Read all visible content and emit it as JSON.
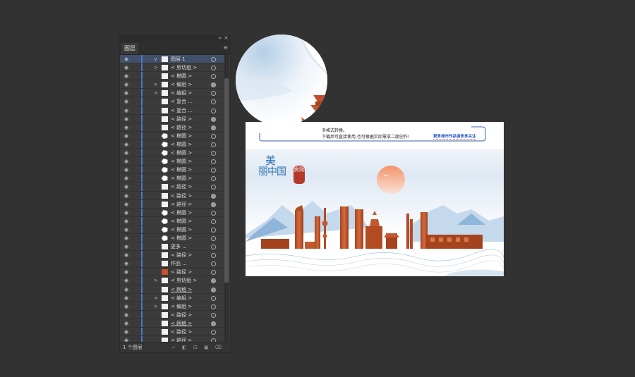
{
  "panel": {
    "tab_label": "图层",
    "collapse_icon": "«",
    "close_icon": "×",
    "menu_icon": "≡",
    "layer_count": "1 个图层",
    "rows": [
      {
        "label": "图层 1",
        "arrow": "∨",
        "layer": true,
        "thumb": "plain",
        "target": "ring"
      },
      {
        "label": "< 剪切组 >",
        "arrow": ">",
        "thumb": "plain",
        "target": "ring"
      },
      {
        "label": "< 椭圆 >",
        "arrow": "",
        "thumb": "plain",
        "target": "ring"
      },
      {
        "label": "< 编组 >",
        "arrow": ">",
        "thumb": "plain",
        "target": "filled"
      },
      {
        "label": "< 编组 >",
        "arrow": ">",
        "thumb": "plain",
        "target": "ring"
      },
      {
        "label": "< 复合 ...",
        "arrow": "",
        "thumb": "plain",
        "target": "ring"
      },
      {
        "label": "< 复合 ...",
        "arrow": "",
        "thumb": "plain",
        "target": "ring"
      },
      {
        "label": "< 路径 >",
        "arrow": "",
        "thumb": "plain",
        "target": "filled"
      },
      {
        "label": "< 路径 >",
        "arrow": "",
        "thumb": "plain",
        "target": "filled"
      },
      {
        "label": "< 椭圆 >",
        "arrow": "",
        "thumb": "dots",
        "target": "ring"
      },
      {
        "label": "< 椭圆 >",
        "arrow": "",
        "thumb": "dots",
        "target": "ring"
      },
      {
        "label": "< 椭圆 >",
        "arrow": "",
        "thumb": "dots",
        "target": "ring"
      },
      {
        "label": "< 椭圆 >",
        "arrow": "",
        "thumb": "dots",
        "target": "ring"
      },
      {
        "label": "< 椭圆 >",
        "arrow": "",
        "thumb": "dots",
        "target": "ring"
      },
      {
        "label": "< 椭圆 >",
        "arrow": "",
        "thumb": "dots",
        "target": "ring"
      },
      {
        "label": "< 路径 >",
        "arrow": "",
        "thumb": "plain",
        "target": "ring"
      },
      {
        "label": "< 路径 >",
        "arrow": "",
        "thumb": "plain",
        "target": "filled"
      },
      {
        "label": "< 路径 >",
        "arrow": "",
        "thumb": "plain",
        "target": "filled"
      },
      {
        "label": "< 椭圆 >",
        "arrow": "",
        "thumb": "dots",
        "target": "ring"
      },
      {
        "label": "< 椭圆 >",
        "arrow": "",
        "thumb": "dots",
        "target": "ring"
      },
      {
        "label": "< 椭圆 >",
        "arrow": "",
        "thumb": "dots",
        "target": "ring"
      },
      {
        "label": "< 椭圆 >",
        "arrow": "",
        "thumb": "dots",
        "target": "ring"
      },
      {
        "label": "更多 ...",
        "arrow": "",
        "thumb": "plain",
        "target": "ring"
      },
      {
        "label": "< 路径 >",
        "arrow": "",
        "thumb": "plain",
        "target": "ring"
      },
      {
        "label": "作品 ...",
        "arrow": "",
        "thumb": "plain",
        "target": "ring"
      },
      {
        "label": "< 路径 >",
        "arrow": "",
        "thumb": "red",
        "target": "ring"
      },
      {
        "label": "< 剪切组 >",
        "arrow": ">",
        "thumb": "plain",
        "target": "filled"
      },
      {
        "label": "< 网格 >",
        "arrow": "",
        "thumb": "plain",
        "target": "filled",
        "under": true
      },
      {
        "label": "< 编组 >",
        "arrow": ">",
        "thumb": "plain",
        "target": "ring"
      },
      {
        "label": "< 编组 >",
        "arrow": ">",
        "thumb": "plain",
        "target": "ring"
      },
      {
        "label": "< 路径 >",
        "arrow": "",
        "thumb": "plain",
        "target": "ring"
      },
      {
        "label": "< 网格 >",
        "arrow": "",
        "thumb": "plain",
        "target": "filled",
        "under": true
      },
      {
        "label": "< 路径 >",
        "arrow": "",
        "thumb": "plain",
        "target": "ring"
      },
      {
        "label": "< 路径 >",
        "arrow": "",
        "thumb": "plain",
        "target": "ring"
      },
      {
        "label": "< 网格 >",
        "arrow": "",
        "thumb": "plain",
        "target": "ring",
        "under": true
      }
    ]
  },
  "artboard": {
    "notice_line1": "多格式转换。",
    "notice_line2": "下载后可直接使用,也可根据实际需求二度创作!",
    "more_link": "更多城市作品请多多关注",
    "title_mei": "美",
    "title_li_zhong_guo": "丽中国",
    "seal_text": "贵阳",
    "colors": {
      "sky": "#e6eef6",
      "orange": "#c8562c",
      "sun": "#f3a27c",
      "mountain": "#9dbfdc",
      "seal": "#b33a2a",
      "title_blue": "#2a6fb1",
      "link_blue": "#1d56c4"
    }
  }
}
